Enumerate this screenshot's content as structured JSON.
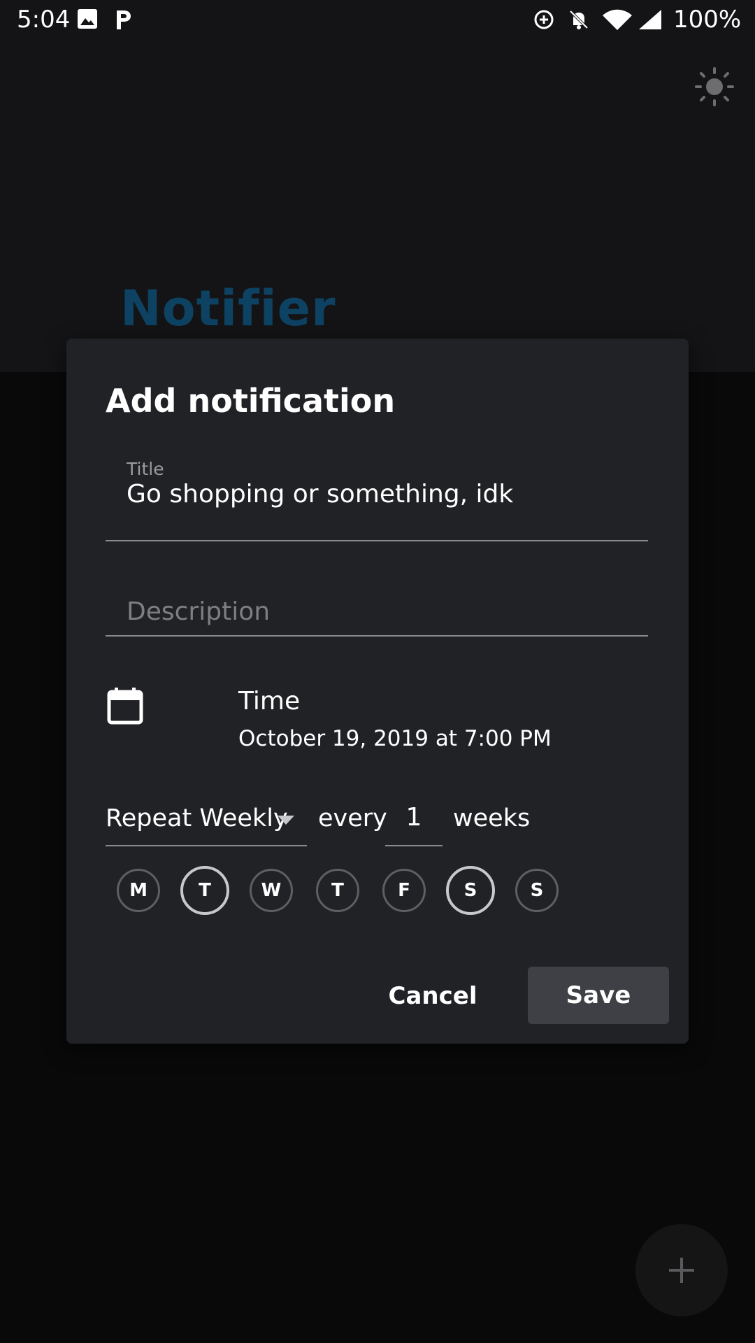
{
  "status_bar": {
    "time": "5:04",
    "battery": "100%",
    "icons": [
      "image-icon",
      "p-app-icon",
      "data-saver-icon",
      "bell-off-icon",
      "wifi-icon",
      "signal-icon"
    ]
  },
  "app": {
    "title": "Notifier",
    "title_color": "#0d4263",
    "theme_icon": "brightness-icon",
    "fab_icon": "plus-icon"
  },
  "dialog": {
    "title": "Add notification",
    "title_field": {
      "label": "Title",
      "value": "Go shopping or something, idk"
    },
    "description_field": {
      "placeholder": "Description",
      "value": ""
    },
    "time": {
      "label": "Time",
      "value": "October 19, 2019 at 7:00 PM",
      "icon": "calendar-icon"
    },
    "repeat": {
      "selected": "Repeat Weekly",
      "every_label": "every",
      "interval": "1",
      "unit_label": "weeks"
    },
    "days": [
      {
        "letter": "M",
        "selected": false
      },
      {
        "letter": "T",
        "selected": true
      },
      {
        "letter": "W",
        "selected": false
      },
      {
        "letter": "T",
        "selected": false
      },
      {
        "letter": "F",
        "selected": false
      },
      {
        "letter": "S",
        "selected": true
      },
      {
        "letter": "S",
        "selected": false
      }
    ],
    "cancel_label": "Cancel",
    "save_label": "Save"
  }
}
